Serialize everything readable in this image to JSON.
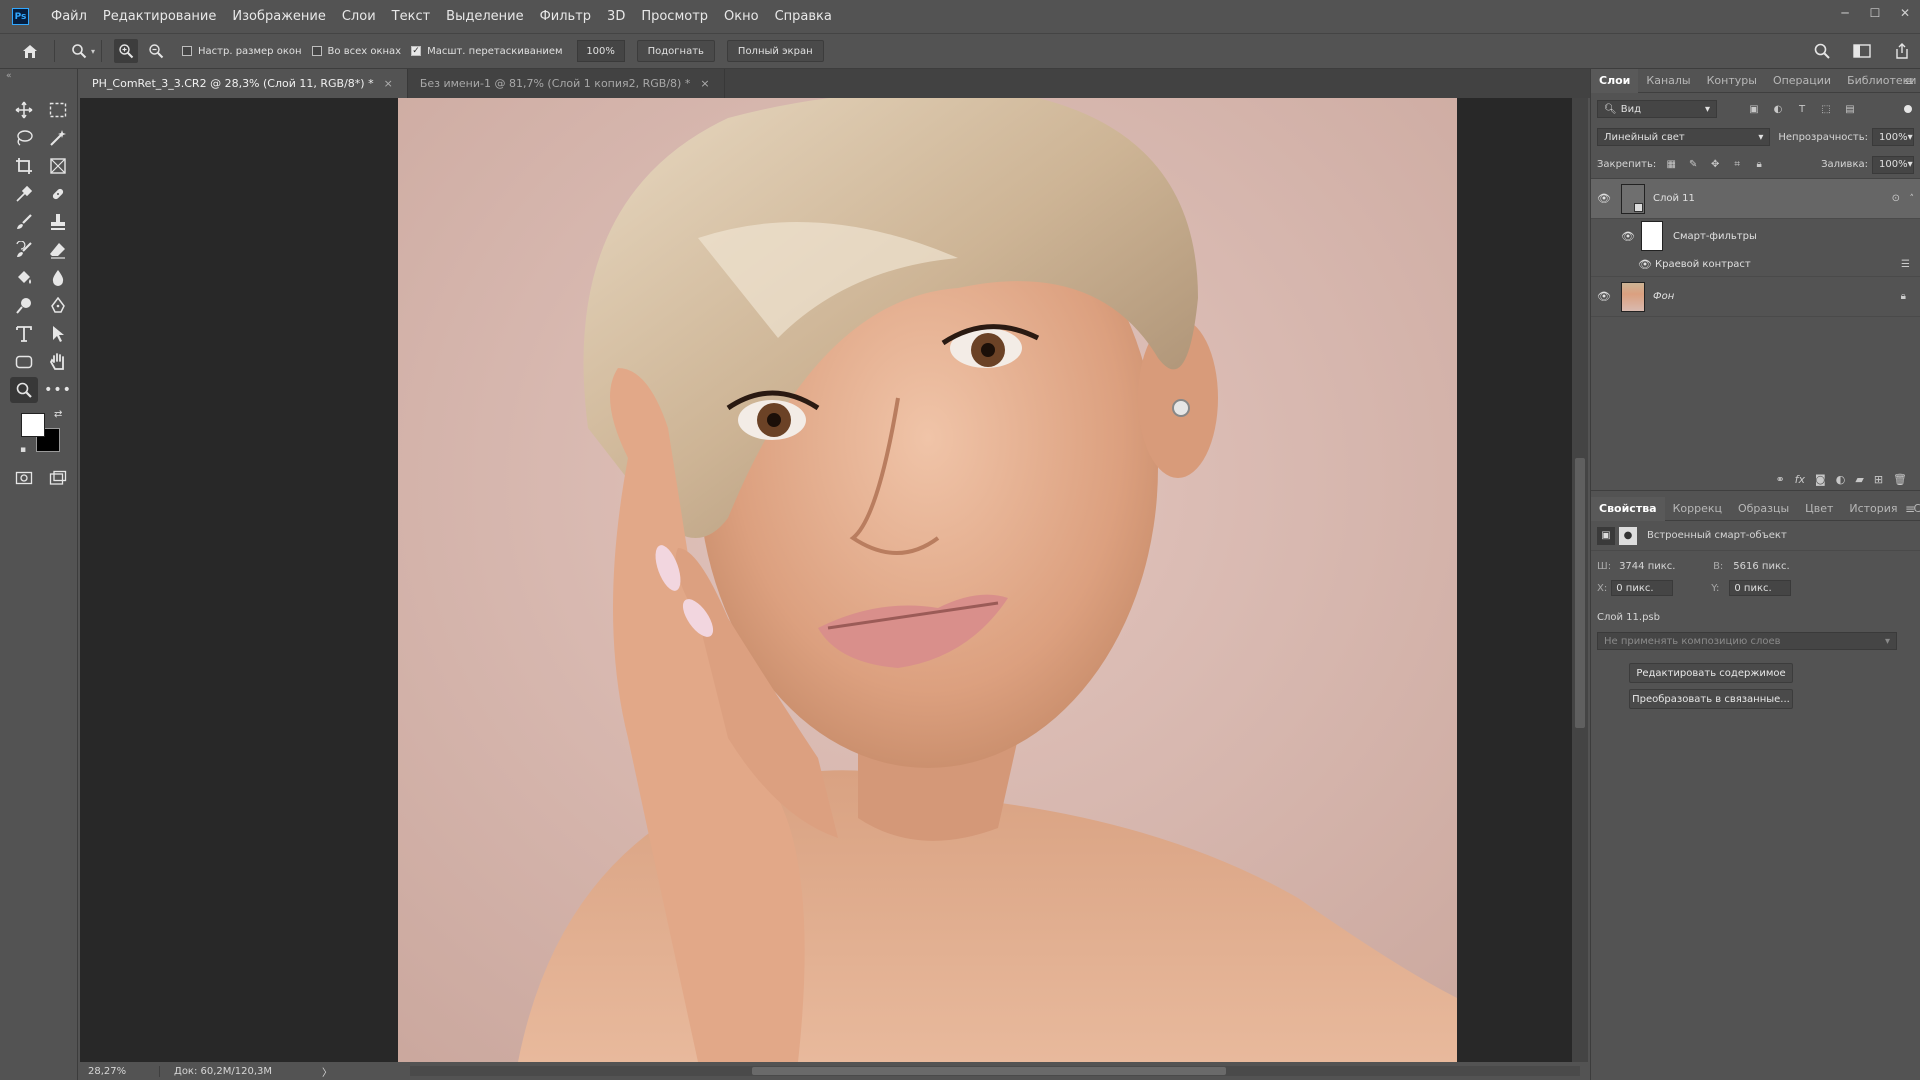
{
  "app": {
    "logo": "Ps"
  },
  "menu": [
    "Файл",
    "Редактирование",
    "Изображение",
    "Слои",
    "Текст",
    "Выделение",
    "Фильтр",
    "3D",
    "Просмотр",
    "Окно",
    "Справка"
  ],
  "options": {
    "resize_windows": "Настр. размер окон",
    "all_windows": "Во всех окнах",
    "scrubby_zoom": "Масшт. перетаскиванием",
    "zoom_value": "100%",
    "fit_button": "Подогнать",
    "fullscreen_button": "Полный экран"
  },
  "tabs": [
    {
      "label": "PH_ComRet_3_3.CR2 @ 28,3% (Слой 11, RGB/8*) *",
      "close": "×"
    },
    {
      "label": "Без имени-1 @ 81,7% (Слой 1 копия2, RGB/8) *",
      "close": "×"
    }
  ],
  "status": {
    "zoom": "28,27%",
    "doc": "Док: 60,2M/120,3M",
    "arrow": "〉"
  },
  "layers_panel": {
    "tabs": [
      "Слои",
      "Каналы",
      "Контуры",
      "Операции",
      "Библиотеки"
    ],
    "filter_kind": "Вид",
    "blend_mode": "Линейный свет",
    "opacity_label": "Непрозрачность:",
    "opacity_value": "100%",
    "lock_label": "Закрепить:",
    "fill_label": "Заливка:",
    "fill_value": "100%",
    "layers": {
      "layer11": "Слой 11",
      "smart_filters": "Смарт-фильтры",
      "filter_effect": "Краевой контраст",
      "background": "Фон"
    }
  },
  "properties_panel": {
    "tabs": [
      "Свойства",
      "Коррекц",
      "Образцы",
      "Цвет",
      "История",
      "Символ"
    ],
    "type": "Встроенный смарт-объект",
    "w_label": "Ш:",
    "w_value": "3744 пикс.",
    "h_label": "В:",
    "h_value": "5616 пикс.",
    "x_label": "X:",
    "x_value": "0 пикс.",
    "y_label": "Y:",
    "y_value": "0 пикс.",
    "file": "Слой 11.psb",
    "comp_placeholder": "Не применять композицию слоев",
    "edit_button": "Редактировать содержимое",
    "convert_button": "Преобразовать в связанные..."
  },
  "colors": {
    "foreground": "#ffffff",
    "background": "#000000",
    "accent": "#31a8ff"
  }
}
